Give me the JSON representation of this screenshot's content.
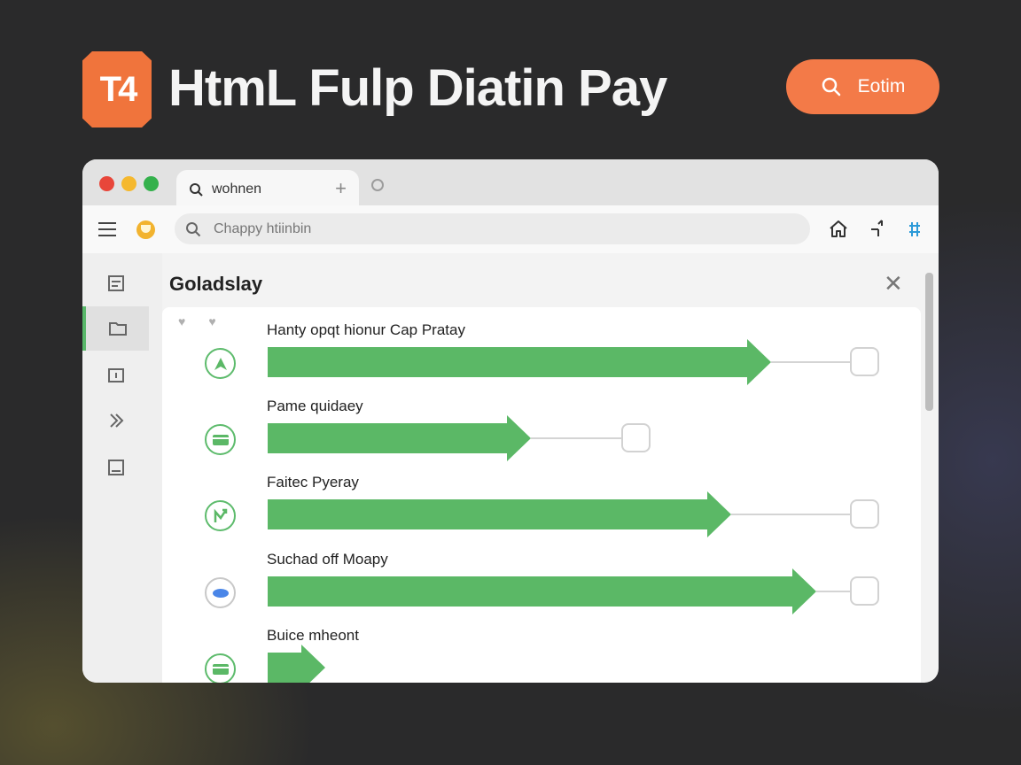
{
  "header": {
    "logo_text": "T4",
    "title": "HtmL Fulp Diatin Pay",
    "action_button_label": "Eotim",
    "accent_color": "#f37a48"
  },
  "browser": {
    "tab": {
      "title": "wohnen"
    },
    "address_bar": {
      "placeholder": "Chappy htiinbin"
    },
    "traffic_lights": [
      "#e8463a",
      "#f5b82e",
      "#34b14c"
    ]
  },
  "panel": {
    "title": "Goladslay",
    "rows": [
      {
        "label": "Hanty opqt hionur Cap Pratay",
        "progress": 0.84,
        "icon": "arrow-up-icon",
        "icon_color": "#5bb866"
      },
      {
        "label": "Pame quidaey",
        "progress": 0.42,
        "icon": "card-icon",
        "icon_color": "#5bb866"
      },
      {
        "label": "Faitec Pyeray",
        "progress": 0.77,
        "icon": "chart-icon",
        "icon_color": "#5bb866"
      },
      {
        "label": "Suchad off Moapy",
        "progress": 0.92,
        "icon": "cloud-icon",
        "icon_color": "#4a86e8"
      },
      {
        "label": "Buice mheont",
        "progress": 0.06,
        "icon": "card-icon",
        "icon_color": "#5bb866"
      }
    ]
  },
  "bar_color": "#5bb866"
}
